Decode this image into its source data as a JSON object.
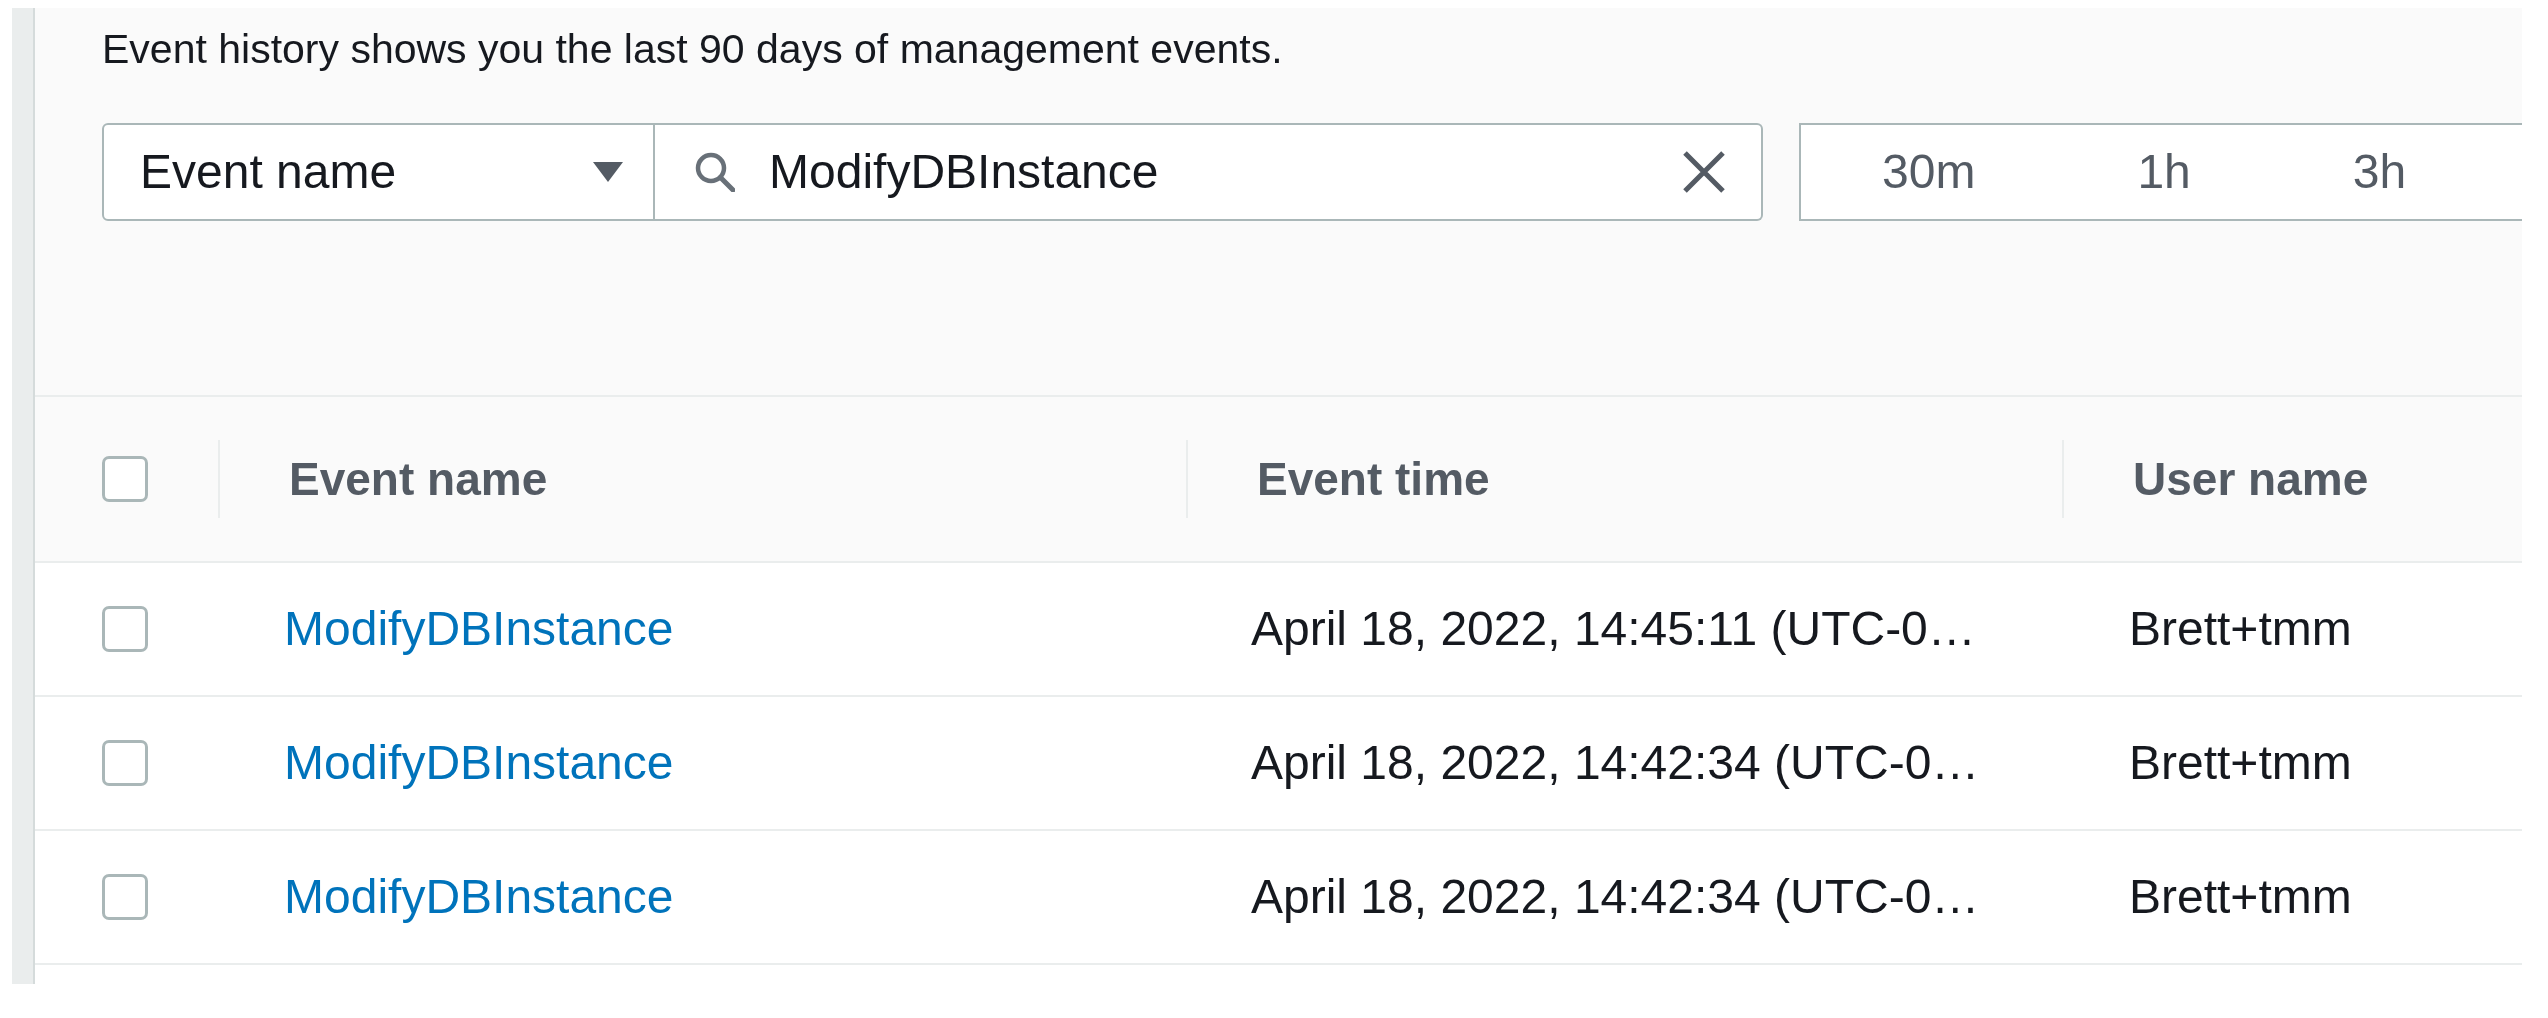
{
  "description": "Event history shows you the last 90 days of management events.",
  "filter": {
    "attribute": "Event name",
    "search": {
      "value": "ModifyDBInstance"
    }
  },
  "time_range": [
    {
      "label": "30m",
      "selected": false
    },
    {
      "label": "1h",
      "selected": false
    },
    {
      "label": "3h",
      "selected": false
    }
  ],
  "table": {
    "select_all": {
      "checked": false
    },
    "columns": [
      "Event name",
      "Event time",
      "User name"
    ],
    "rows": [
      {
        "checked": false,
        "event_name": "ModifyDBInstance",
        "event_time": "April 18, 2022, 14:45:11 (UTC-0…",
        "user_name": "Brett+tmm"
      },
      {
        "checked": false,
        "event_name": "ModifyDBInstance",
        "event_time": "April 18, 2022, 14:42:34 (UTC-0…",
        "user_name": "Brett+tmm"
      },
      {
        "checked": false,
        "event_name": "ModifyDBInstance",
        "event_time": "April 18, 2022, 14:42:34 (UTC-0…",
        "user_name": "Brett+tmm"
      }
    ]
  }
}
